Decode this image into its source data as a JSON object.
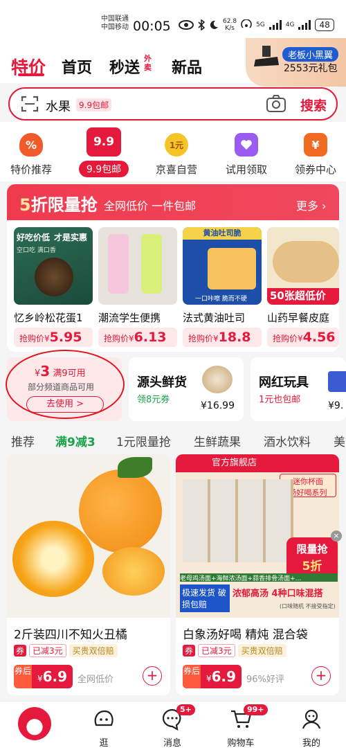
{
  "status": {
    "carrier1": "中国联通",
    "carrier2": "中国移动",
    "time": "00:05",
    "speed_value": "62.8",
    "speed_unit": "K/s",
    "net1": "5G",
    "net2": "4G",
    "battery": "48"
  },
  "topnav": {
    "items": [
      "特价",
      "首页",
      "秒送",
      "新品"
    ],
    "miaosong_tag": "外卖",
    "promo_badge": "老板小黑翼",
    "promo_text": "2553元礼包"
  },
  "search": {
    "text": "水果",
    "tag": "9.9包邮",
    "button": "搜索"
  },
  "categories": [
    {
      "label": "特价推荐",
      "icon_text": "%"
    },
    {
      "label": "9.9包邮",
      "icon_text": "9.9"
    },
    {
      "label": "京喜自营",
      "icon_text": "1元"
    },
    {
      "label": "试用领取",
      "icon_text": ""
    },
    {
      "label": "领券中心",
      "icon_text": "¥"
    }
  ],
  "flash": {
    "title_big": "5",
    "title_rest": "折限量抢",
    "subtitle": "全网低价 一件包邮",
    "more": "更多",
    "price_prefix": "抢购价¥",
    "products": [
      {
        "name": "忆乡岭松花蛋1",
        "price": "5.95",
        "img_caption1": "好吃价低",
        "img_caption2": "才是实惠",
        "img_caption3": "空口吃 满口香"
      },
      {
        "name": "潮流学生便携",
        "price": "6.13",
        "img_caption1": "",
        "img_caption2": "",
        "img_caption3": ""
      },
      {
        "name": "法式黄油吐司",
        "price": "18.8",
        "img_caption1": "黄油吐司脆",
        "img_caption2": "一口咔嚓 脆而不硬",
        "img_caption3": ""
      },
      {
        "name": "山药早餐皮庭",
        "price": "4.56",
        "img_caption1": "50张超低价",
        "img_caption2": "",
        "img_caption3": ""
      }
    ]
  },
  "coupon": {
    "currency": "¥",
    "amount": "3",
    "condition": "满9可用",
    "desc": "部分频道商品可用",
    "button": "去使用 >"
  },
  "mini_cards": [
    {
      "title": "源头鲜货",
      "sub": "领8元券",
      "price": "¥16.99"
    },
    {
      "title": "网红玩具",
      "sub": "1元也包邮",
      "price": "¥9."
    }
  ],
  "tabs": [
    "推荐",
    "满9减3",
    "1元限量抢",
    "生鲜蔬果",
    "酒水饮料",
    "美"
  ],
  "feed": [
    {
      "name": "2斤装四川不知火丑橘",
      "tag_coupon": "券",
      "tag_save": "已减3元",
      "tag_guarantee": "买贵双倍赔",
      "price_label": "券后",
      "price": "6.9",
      "extra": "全网低价"
    },
    {
      "name": "白象汤好喝 精炖 混合袋",
      "tag_coupon": "券",
      "tag_save": "已减3元",
      "tag_guarantee": "买贵双倍赔",
      "price_label": "券后",
      "price": "6.9",
      "extra": "96%好评",
      "img_store": "官方旗舰店",
      "img_series": "汤好喝系列",
      "img_series_top": "迷你杯面",
      "img_limit": "限量抢",
      "img_limit_pct": "5折",
      "img_ship": "极速发货 破损包赔",
      "img_mix": "浓郁高汤 4种口味混搭",
      "img_mix_note": "(口味随机 不接受指定)",
      "img_flavors": "老母鸡汤面+海鲜浓汤面+蒜香排骨汤面+..."
    }
  ],
  "bottomnav": [
    {
      "label": "",
      "badge": ""
    },
    {
      "label": "逛",
      "badge": ""
    },
    {
      "label": "消息",
      "badge": "5+"
    },
    {
      "label": "购物车",
      "badge": "99+"
    },
    {
      "label": "我的",
      "badge": ""
    }
  ],
  "colors": {
    "accent": "#e4193b",
    "green": "#1aa34a"
  }
}
